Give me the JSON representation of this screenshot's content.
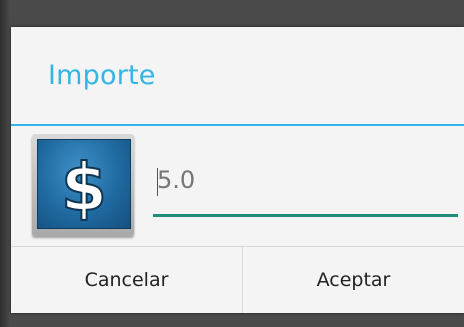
{
  "dialog": {
    "title": "Importe",
    "accent_color": "#33b5e5",
    "icon": "dollar-sign-icon",
    "amount_input": {
      "placeholder": "5.0",
      "value": ""
    },
    "buttons": {
      "cancel_label": "Cancelar",
      "accept_label": "Aceptar"
    }
  }
}
